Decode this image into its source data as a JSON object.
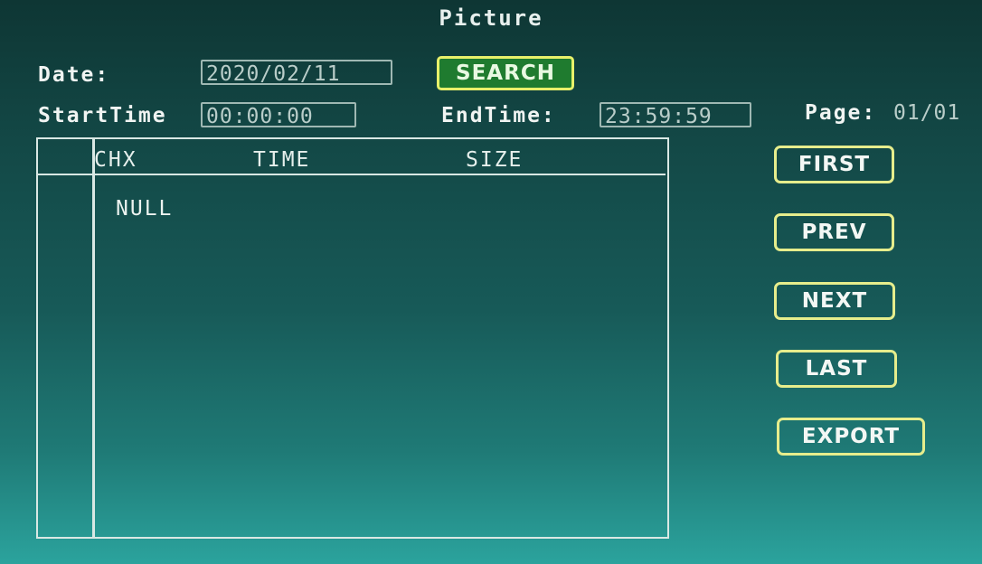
{
  "title": "Picture",
  "search": {
    "date_label": "Date:",
    "date_value": "2020/02/11",
    "search_label": "SEARCH",
    "start_label": "StartTime",
    "start_value": "00:00:00",
    "end_label": "EndTime:",
    "end_value": "23:59:59",
    "page_label": "Page:",
    "page_value": "01/01"
  },
  "table": {
    "columns": [
      "CHX",
      "TIME",
      "SIZE"
    ],
    "rows": [],
    "empty_text": "NULL"
  },
  "nav": {
    "first": "FIRST",
    "prev": "PREV",
    "next": "NEXT",
    "last": "LAST",
    "export": "EXPORT"
  },
  "colors": {
    "background": "#175a58",
    "search_button": "#1f7b2f",
    "button_border": "#e6ed8c",
    "text": "#ffffff",
    "field_border": "#9fb8b3"
  }
}
